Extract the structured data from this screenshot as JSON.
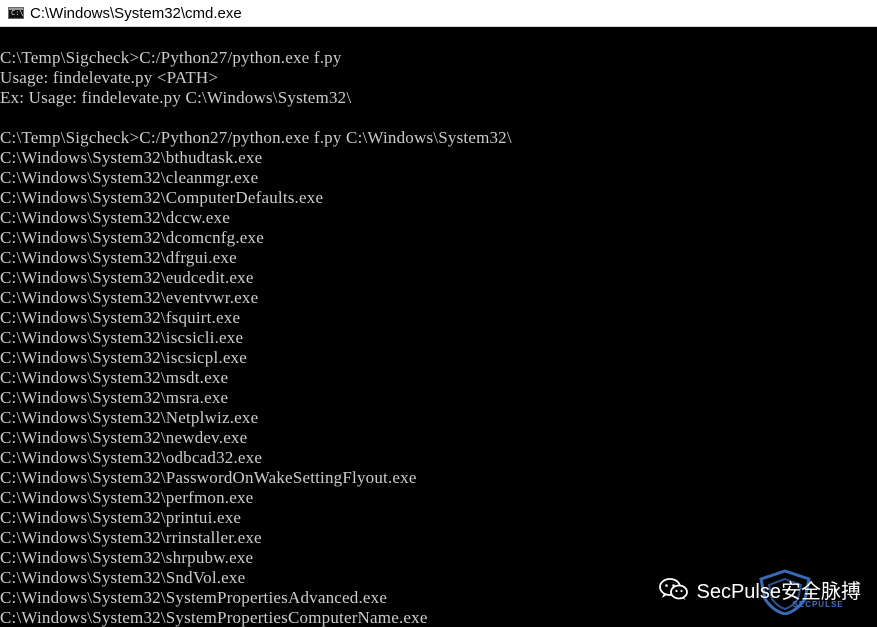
{
  "window": {
    "title": "C:\\Windows\\System32\\cmd.exe",
    "icon": "console-app-icon",
    "icon_prompt": "C:\\"
  },
  "console": {
    "background": "#000000",
    "foreground": "#cccccc",
    "lines": [
      "C:\\Temp\\Sigcheck>C:/Python27/python.exe f.py",
      "Usage: findelevate.py <PATH>",
      "Ex: Usage: findelevate.py C:\\Windows\\System32\\",
      "",
      "C:\\Temp\\Sigcheck>C:/Python27/python.exe f.py C:\\Windows\\System32\\",
      "C:\\Windows\\System32\\bthudtask.exe",
      "C:\\Windows\\System32\\cleanmgr.exe",
      "C:\\Windows\\System32\\ComputerDefaults.exe",
      "C:\\Windows\\System32\\dccw.exe",
      "C:\\Windows\\System32\\dcomcnfg.exe",
      "C:\\Windows\\System32\\dfrgui.exe",
      "C:\\Windows\\System32\\eudcedit.exe",
      "C:\\Windows\\System32\\eventvwr.exe",
      "C:\\Windows\\System32\\fsquirt.exe",
      "C:\\Windows\\System32\\iscsicli.exe",
      "C:\\Windows\\System32\\iscsicpl.exe",
      "C:\\Windows\\System32\\msdt.exe",
      "C:\\Windows\\System32\\msra.exe",
      "C:\\Windows\\System32\\Netplwiz.exe",
      "C:\\Windows\\System32\\newdev.exe",
      "C:\\Windows\\System32\\odbcad32.exe",
      "C:\\Windows\\System32\\PasswordOnWakeSettingFlyout.exe",
      "C:\\Windows\\System32\\perfmon.exe",
      "C:\\Windows\\System32\\printui.exe",
      "C:\\Windows\\System32\\rrinstaller.exe",
      "C:\\Windows\\System32\\shrpubw.exe",
      "C:\\Windows\\System32\\SndVol.exe",
      "C:\\Windows\\System32\\SystemPropertiesAdvanced.exe",
      "C:\\Windows\\System32\\SystemPropertiesComputerName.exe"
    ]
  },
  "watermark": {
    "text": "SecPulse安全脉搏",
    "sub": "SECPULSE",
    "icons": [
      "wechat-icon",
      "secpulse-shield-icon"
    ]
  }
}
